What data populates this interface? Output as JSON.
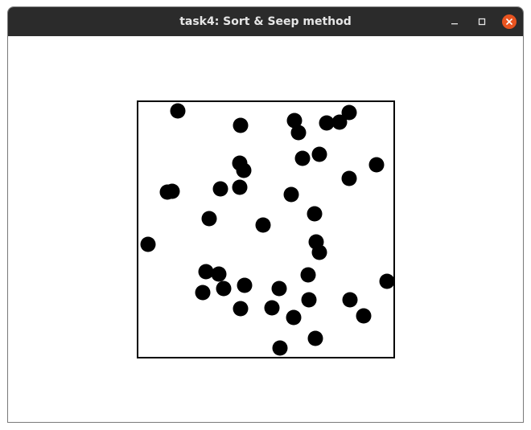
{
  "window": {
    "title": "task4: Sort & Seep method"
  },
  "controls": {
    "minimize_icon": "minimize-icon",
    "maximize_icon": "maximize-icon",
    "close_icon": "close-icon",
    "close_color": "#e95420"
  },
  "simulation": {
    "ball_color": "#000000",
    "box_border_color": "#000000",
    "ball_count": 40
  }
}
